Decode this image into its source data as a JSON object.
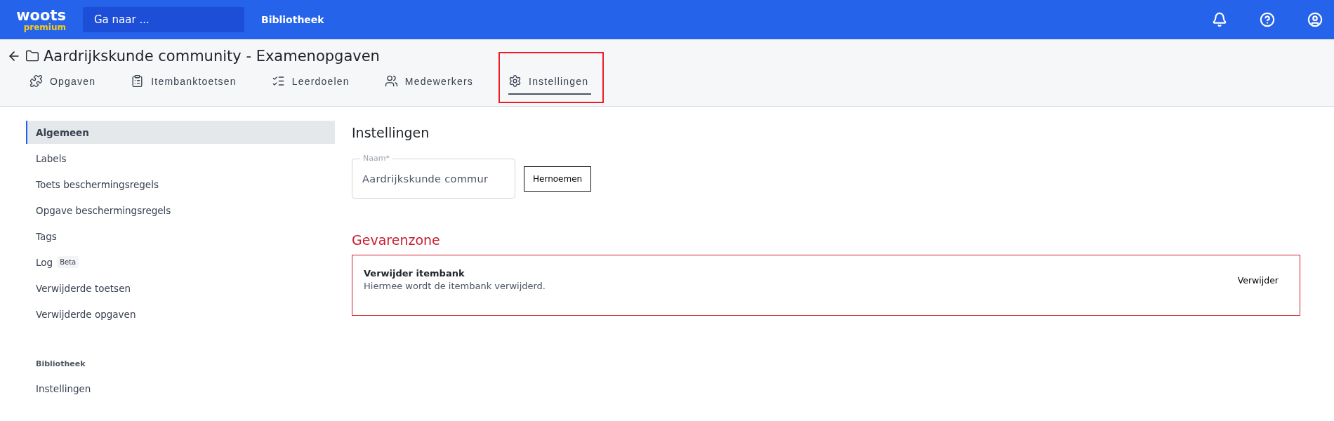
{
  "topbar": {
    "logo": {
      "name": "woots",
      "tier": "premium"
    },
    "search": {
      "placeholder": "Ga naar ..."
    },
    "links": [
      {
        "label": "Bibliotheek"
      }
    ]
  },
  "header": {
    "title": "Aardrijkskunde community - Examenopgaven",
    "tabs": [
      {
        "label": "Opgaven",
        "selected": false,
        "highlighted": false
      },
      {
        "label": "Itembanktoetsen",
        "selected": false,
        "highlighted": false
      },
      {
        "label": "Leerdoelen",
        "selected": false,
        "highlighted": false
      },
      {
        "label": "Medewerkers",
        "selected": false,
        "highlighted": false
      },
      {
        "label": "Instellingen",
        "selected": true,
        "highlighted": true
      }
    ]
  },
  "sidebar": {
    "items": [
      {
        "label": "Algemeen",
        "selected": true
      },
      {
        "label": "Labels",
        "selected": false
      },
      {
        "label": "Toets beschermingsregels",
        "selected": false
      },
      {
        "label": "Opgave beschermingsregels",
        "selected": false
      },
      {
        "label": "Tags",
        "selected": false
      },
      {
        "label": "Log",
        "badge": "Beta",
        "selected": false
      },
      {
        "label": "Verwijderde toetsen",
        "selected": false
      },
      {
        "label": "Verwijderde opgaven",
        "selected": false
      }
    ],
    "section": {
      "title": "Bibliotheek",
      "items": [
        {
          "label": "Instellingen",
          "selected": false
        }
      ]
    }
  },
  "main": {
    "title": "Instellingen",
    "name_field": {
      "label": "Naam*",
      "value": "Aardrijkskunde commur"
    },
    "rename_button": "Hernoemen",
    "danger_zone": {
      "title": "Gevarenzone",
      "items": [
        {
          "title": "Verwijder itembank",
          "description": "Hiermee wordt de itembank verwijderd.",
          "button": "Verwijder"
        }
      ]
    }
  }
}
